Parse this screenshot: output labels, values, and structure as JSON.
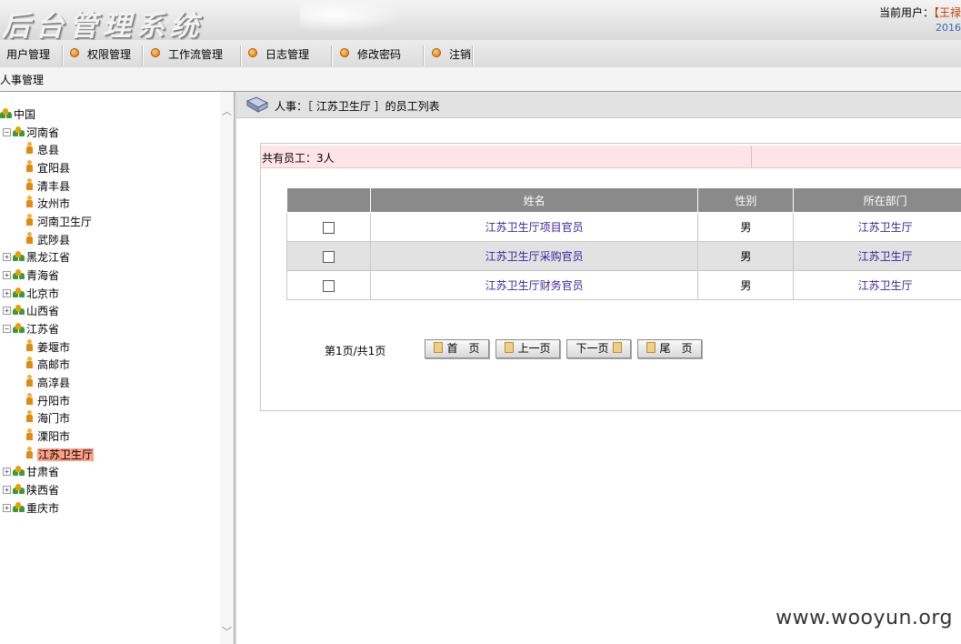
{
  "header": {
    "app_title": "后台管理系统",
    "current_user_label": "当前用户：",
    "user_name": "【王禄",
    "date": "2016"
  },
  "menu": [
    {
      "label": "用户管理",
      "icon": "none"
    },
    {
      "label": "权限管理",
      "icon": "orange-bullet-icon"
    },
    {
      "label": "工作流管理",
      "icon": "orange-bullet-icon"
    },
    {
      "label": "日志管理",
      "icon": "orange-bullet-icon"
    },
    {
      "label": "修改密码",
      "icon": "orange-bullet-icon"
    },
    {
      "label": "注销",
      "icon": "orange-bullet-icon"
    }
  ],
  "breadcrumb": "人事管理",
  "tree": {
    "root": "中国",
    "nodes": [
      {
        "label": "河南省",
        "type": "group",
        "expanded": true
      },
      {
        "label": "息县",
        "type": "person"
      },
      {
        "label": "宜阳县",
        "type": "person"
      },
      {
        "label": "清丰县",
        "type": "person"
      },
      {
        "label": "汝州市",
        "type": "person"
      },
      {
        "label": "河南卫生厅",
        "type": "person"
      },
      {
        "label": "武陟县",
        "type": "person"
      },
      {
        "label": "黑龙江省",
        "type": "group",
        "expanded": false
      },
      {
        "label": "青海省",
        "type": "group",
        "expanded": false
      },
      {
        "label": "北京市",
        "type": "group",
        "expanded": false
      },
      {
        "label": "山西省",
        "type": "group",
        "expanded": false
      },
      {
        "label": "江苏省",
        "type": "group",
        "expanded": true
      },
      {
        "label": "姜堰市",
        "type": "person"
      },
      {
        "label": "高邮市",
        "type": "person"
      },
      {
        "label": "高淳县",
        "type": "person"
      },
      {
        "label": "丹阳市",
        "type": "person"
      },
      {
        "label": "海门市",
        "type": "person"
      },
      {
        "label": "溧阳市",
        "type": "person"
      },
      {
        "label": "江苏卫生厅",
        "type": "person",
        "selected": true
      },
      {
        "label": "甘肃省",
        "type": "group",
        "expanded": false
      },
      {
        "label": "陕西省",
        "type": "group",
        "expanded": false
      },
      {
        "label": "重庆市",
        "type": "group",
        "expanded": false
      }
    ]
  },
  "main": {
    "heading": "人事：［ 江苏卫生厅 ］的员工列表",
    "count_text": "共有员工：3人",
    "columns": [
      "",
      "姓名",
      "性别",
      "所在部门"
    ],
    "rows": [
      {
        "name": "江苏卫生厅项目官员",
        "gender": "男",
        "dept": "江苏卫生厅"
      },
      {
        "name": "江苏卫生厅采购官员",
        "gender": "男",
        "dept": "江苏卫生厅"
      },
      {
        "name": "江苏卫生厅财务官员",
        "gender": "男",
        "dept": "江苏卫生厅"
      }
    ],
    "pager": {
      "text": "第1页/共1页",
      "first": "首　页",
      "prev": "上一页",
      "next": "下一页",
      "last": "尾　页"
    }
  },
  "watermark": "www.wooyun.org",
  "colors": {
    "selected_node": "#ff9f86",
    "count_bar": "#ffe4ea",
    "table_header": "#8a8a8a",
    "link": "#3a1ea0"
  }
}
